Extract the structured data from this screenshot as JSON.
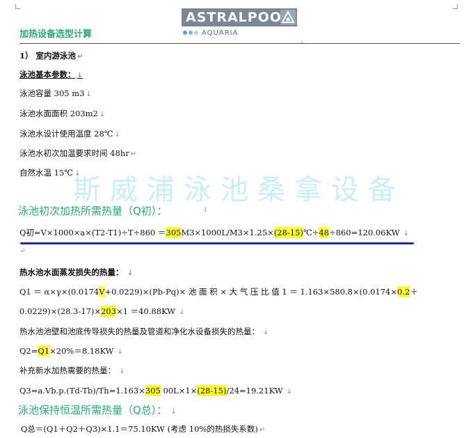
{
  "logo": {
    "brand": "ASTRALPOOL",
    "sub": "AQUARIA"
  },
  "doc": {
    "title": "加热设备选型计算",
    "section": "1） 室内游泳池",
    "params_heading": "泳池基本参数：",
    "params": [
      "泳池容量 305 m3",
      "泳池水面面积 203m2",
      "泳池水设计使用温度 28℃",
      "泳池水初次加温要求时间 48hr",
      "自然水温 15℃"
    ],
    "watermark": "斯威浦泳池桑拿设备",
    "q_initial_heading": "泳池初次加热所需热量（Q初）：",
    "q_initial_formula": {
      "a": "Q初=V×1000×a×(T2-T1)÷T÷860 ＝",
      "h1": "305",
      "b": "M3×1000L/M3×1.25×",
      "h2": "(28-15)",
      "c": "℃÷",
      "h3": "48",
      "d": "÷860=120.06KW"
    },
    "evap_heading": "热水池水面蒸发损失的热量：",
    "q1_line1": {
      "a": "Q1 ＝ α×γ×(0.0174",
      "h1": "V",
      "b": "+0.0229)×(Pb-Pq)× 池 面 积 × 大 气 压 比 值  1 ＝ 1.163×580.8×(0.0174×",
      "h2": "0.2",
      "c": "＋"
    },
    "q1_line2": {
      "a": "0.0229)×(28.3-17)×",
      "h1": "203",
      "b": "×1  ＝40.88KW"
    },
    "wall_heading": "热水池池壁和池底传导损失的热量及管道和净化水设备损失的热量：",
    "q2": {
      "a": "Q2=",
      "h1": "Q1",
      "b": "×20%＝8.18KW"
    },
    "fresh_heading": "补充新水加热需要的热量：",
    "q3": {
      "a": "Q3=a.Vb.p.(Td-Tb)/Th=1.163×",
      "h1": "305",
      "b": " 00L×1×",
      "h2": "(28-15)",
      "c": "/24=19.21KW"
    },
    "q_total_heading": "泳池保持恒温所需热量（Q总）：",
    "q_total": "Q总＝(Q1＋Q2＋Q3)×1.1＝75.10KW (考虑 10%的热损失系数)"
  },
  "colors": {
    "accent_green": "#2aa876",
    "highlight": "#ffff33",
    "underline_blue": "#1f2a9c",
    "logo_gray": "#7b8794"
  }
}
